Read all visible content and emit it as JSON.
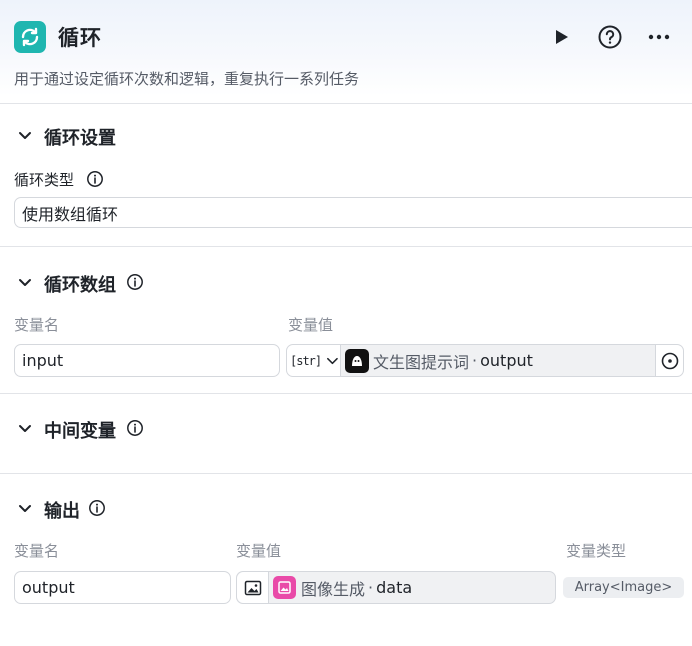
{
  "header": {
    "title": "循环",
    "description": "用于通过设定循环次数和逻辑，重复执行一系列任务",
    "icons": {
      "app": "loop-icon",
      "run": "play-icon",
      "help": "help-icon",
      "more": "more-icon"
    }
  },
  "loop_settings": {
    "title": "循环设置",
    "type_label": "循环类型",
    "type_value": "使用数组循环"
  },
  "loop_array": {
    "title": "循环数组",
    "col_name": "变量名",
    "col_value": "变量值",
    "var_name": "input",
    "type_tag": "str",
    "ref_node": "文生图提示词",
    "ref_sep": "·",
    "ref_output": "output"
  },
  "intermediate": {
    "title": "中间变量"
  },
  "output": {
    "title": "输出",
    "col_name": "变量名",
    "col_value": "变量值",
    "col_type": "变量类型",
    "var_name": "output",
    "ref_node": "图像生成",
    "ref_sep": "·",
    "ref_output": "data",
    "var_type": "Array<Image>"
  },
  "colors": {
    "accent": "#1fb6b0",
    "image_node": "#e94aa8",
    "prompt_node": "#111111"
  }
}
